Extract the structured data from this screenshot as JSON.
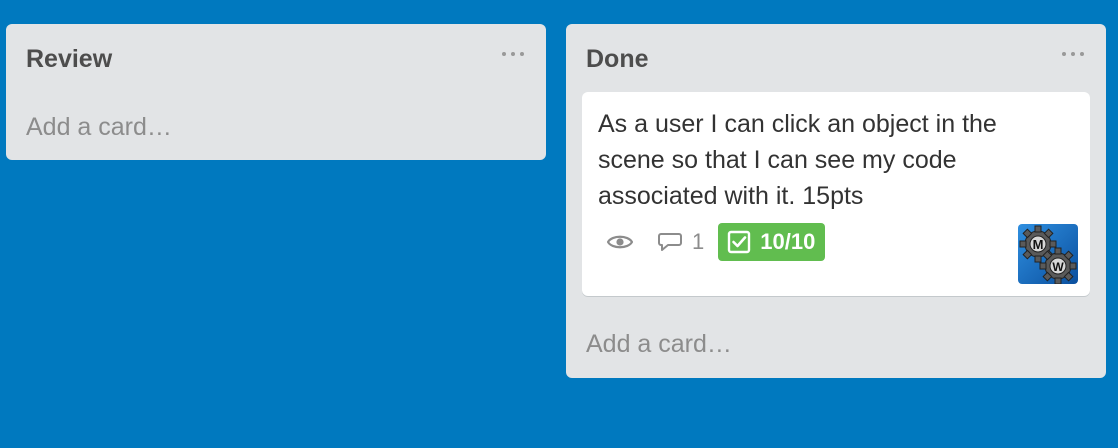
{
  "board": {
    "background_color": "#0079bf",
    "lists": [
      {
        "title": "Review",
        "add_card_label": "Add a card…",
        "menu_icon": "more-horizontal-icon"
      },
      {
        "title": "Done",
        "add_card_label": "Add a card…",
        "menu_icon": "more-horizontal-icon",
        "cards": [
          {
            "title": "As a user I can click an object in the scene so that I can see my code associated with it. 15pts",
            "badges": {
              "watch_icon": "eye-icon",
              "comment_icon": "comment-icon",
              "comment_count": "1",
              "checklist_icon": "checkbox-icon",
              "checklist": "10/10",
              "checklist_color": "#61bd4f"
            },
            "member_avatar": {
              "letters": [
                "M",
                "W"
              ],
              "icon": "gears-avatar-icon"
            }
          }
        ]
      }
    ]
  }
}
